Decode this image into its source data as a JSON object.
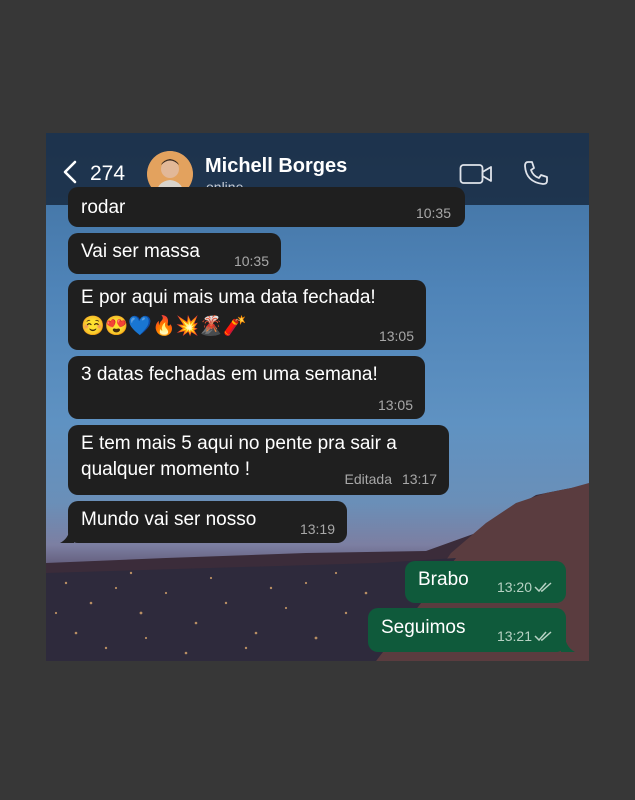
{
  "header": {
    "back_count": "274",
    "contact_name": "Michell Borges",
    "contact_status": "online"
  },
  "messages": [
    {
      "text": "rodar",
      "time": "10:35",
      "direction": "in"
    },
    {
      "text": "Vai ser massa",
      "time": "10:35",
      "direction": "in"
    },
    {
      "text": "E por aqui mais uma data fechada!",
      "emojis": "☺️😍💙🔥💥🌋🧨",
      "time": "13:05",
      "direction": "in"
    },
    {
      "text": "3 datas fechadas em uma semana!",
      "time": "13:05",
      "direction": "in"
    },
    {
      "lines": [
        "E tem mais 5 aqui no pente pra sair a",
        "qualquer momento !"
      ],
      "edited_label": "Editada",
      "time": "13:17",
      "direction": "in"
    },
    {
      "text": "Mundo vai ser nosso",
      "time": "13:19",
      "direction": "in"
    },
    {
      "text": "Brabo",
      "time": "13:20",
      "direction": "out",
      "read": true
    },
    {
      "text": "Seguimos",
      "time": "13:21",
      "direction": "out",
      "read": true
    }
  ],
  "colors": {
    "incoming_bubble": "#1f1f1f",
    "outgoing_bubble": "#0f5a3b",
    "header_bg": "#16263a"
  }
}
